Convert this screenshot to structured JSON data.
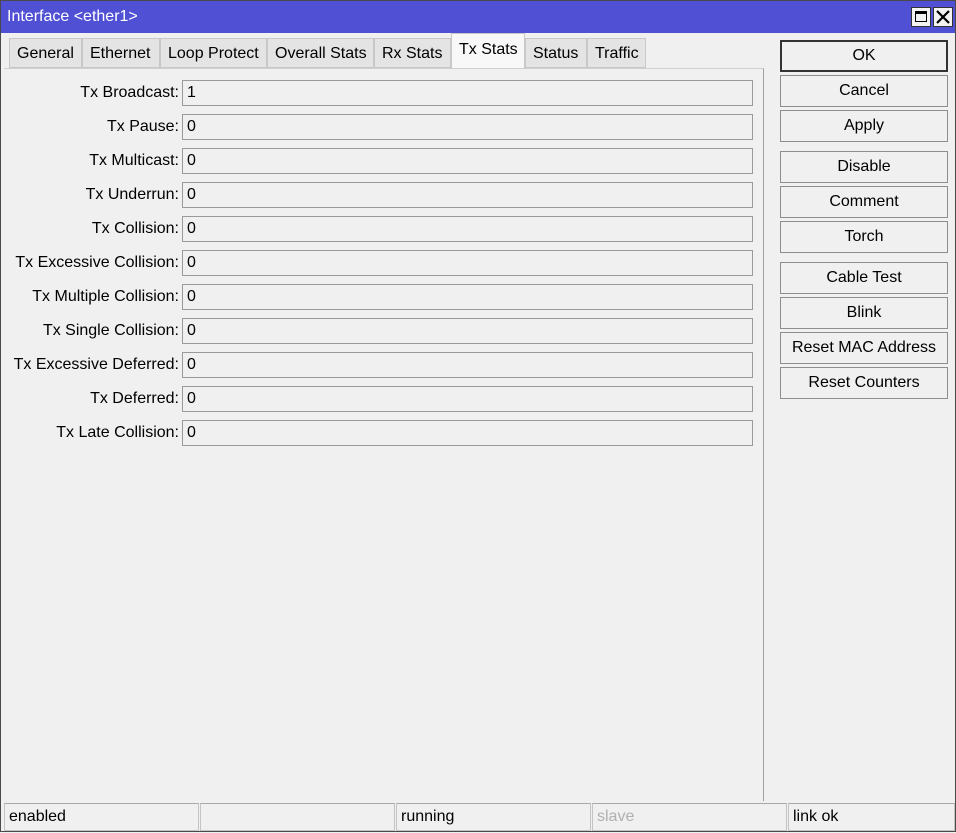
{
  "window": {
    "title": "Interface <ether1>"
  },
  "icons": {
    "maximize": "maximize-icon",
    "close": "close-icon"
  },
  "tabs": [
    {
      "label": "General",
      "active": false
    },
    {
      "label": "Ethernet",
      "active": false
    },
    {
      "label": "Loop Protect",
      "active": false
    },
    {
      "label": "Overall Stats",
      "active": false
    },
    {
      "label": "Rx Stats",
      "active": false
    },
    {
      "label": "Tx Stats",
      "active": true
    },
    {
      "label": "Status",
      "active": false
    },
    {
      "label": "Traffic",
      "active": false
    }
  ],
  "fields": [
    {
      "label": "Tx Broadcast:",
      "value": "1"
    },
    {
      "label": "Tx Pause:",
      "value": "0"
    },
    {
      "label": "Tx Multicast:",
      "value": "0"
    },
    {
      "label": "Tx Underrun:",
      "value": "0"
    },
    {
      "label": "Tx Collision:",
      "value": "0"
    },
    {
      "label": "Tx Excessive Collision:",
      "value": "0"
    },
    {
      "label": "Tx Multiple Collision:",
      "value": "0"
    },
    {
      "label": "Tx Single Collision:",
      "value": "0"
    },
    {
      "label": "Tx Excessive Deferred:",
      "value": "0"
    },
    {
      "label": "Tx Deferred:",
      "value": "0"
    },
    {
      "label": "Tx Late Collision:",
      "value": "0"
    }
  ],
  "buttons": {
    "ok": "OK",
    "cancel": "Cancel",
    "apply": "Apply",
    "disable": "Disable",
    "comment": "Comment",
    "torch": "Torch",
    "cable_test": "Cable Test",
    "blink": "Blink",
    "reset_mac": "Reset MAC Address",
    "reset_counters": "Reset Counters"
  },
  "status": {
    "enabled": "enabled",
    "cell2": "",
    "running": "running",
    "slave": "slave",
    "link": "link ok"
  },
  "colors": {
    "titlebar": "#5050d4",
    "background": "#f0f0f0",
    "dim_text": "#b0b0b0"
  }
}
